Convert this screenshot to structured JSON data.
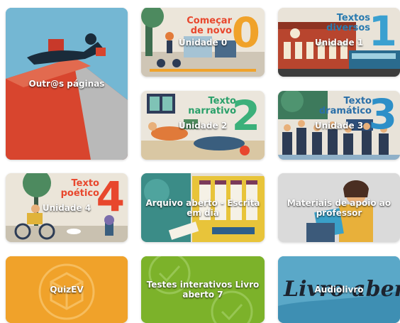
{
  "tiles": {
    "outras": {
      "label": "Outr@s páginas"
    },
    "u0": {
      "label": "Unidade 0",
      "title_line1": "Começar",
      "title_line2": "de novo",
      "number": "0"
    },
    "u1": {
      "label": "Unidade 1",
      "title_line1": "Textos",
      "title_line2": "diversos",
      "number": "1"
    },
    "u2": {
      "label": "Unidade 2",
      "title_line1": "Texto",
      "title_line2": "narrativo",
      "number": "2"
    },
    "u3": {
      "label": "Unidade 3",
      "title_line1": "Texto",
      "title_line2": "dramático",
      "number": "3"
    },
    "u4": {
      "label": "Unidade 4",
      "title_line1": "Texto",
      "title_line2": "poético",
      "number": "4"
    },
    "arquivo": {
      "label": "Arquivo aberto - Escrita em dia"
    },
    "materiais": {
      "label": "Materiais de apoio ao professor"
    },
    "quizev": {
      "label": "QuizEV"
    },
    "testes": {
      "label": "Testes interativos Livro aberto 7"
    },
    "audiolivro": {
      "label": "Audiolivro",
      "art_text": "Livro aberto"
    }
  },
  "colors": {
    "orange": "#f0a22a",
    "green": "#7cb22a",
    "teal": "#3aa7a3",
    "red": "#e8472d",
    "blue_num": "#3aa0d0"
  }
}
